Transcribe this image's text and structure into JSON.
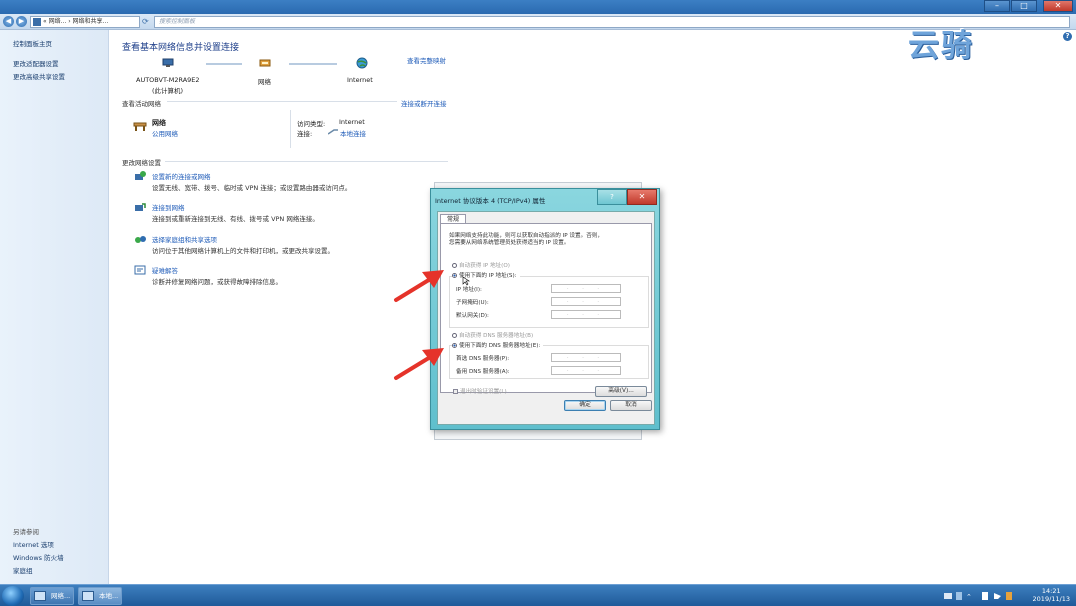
{
  "window": {
    "minimize": "–",
    "maximize": "□",
    "close": "✕"
  },
  "address_bar": {
    "back": "◀",
    "forward": "▶",
    "path": "« 网络... › 网络和共享...",
    "search_placeholder": "搜索控制面板"
  },
  "left_pane": {
    "links": [
      "控制面板主页",
      "更改适配器设置",
      "更改高级共享设置"
    ],
    "see_also_title": "另请参阅",
    "see_also": [
      "Internet 选项",
      "Windows 防火墙",
      "家庭组"
    ]
  },
  "main": {
    "title": "查看基本网络信息并设置连接",
    "view_full_map": "查看完整映射",
    "map": {
      "computer_name": "AUTOBVT-M2RA9E2",
      "computer_sub": "(此计算机)",
      "network": "网络",
      "internet": "Internet"
    },
    "active_networks_title": "查看活动网络",
    "connect_disconnect": "连接或断开连接",
    "active": {
      "name": "网络",
      "type": "公用网络",
      "access_label": "访问类型:",
      "access_value": "Internet",
      "conn_label": "连接:",
      "conn_value": "本地连接"
    },
    "change_title": "更改网络设置",
    "tasks": [
      {
        "title": "设置新的连接或网络",
        "desc": "设置无线、宽带、拨号、临时或 VPN 连接；或设置路由器或访问点。"
      },
      {
        "title": "连接到网络",
        "desc": "连接到或重新连接到无线、有线、拨号或 VPN 网络连接。"
      },
      {
        "title": "选择家庭组和共享选项",
        "desc": "访问位于其他网络计算机上的文件和打印机，或更改共享设置。"
      },
      {
        "title": "疑难解答",
        "desc": "诊断并修复网络问题，或获得故障排除信息。"
      }
    ]
  },
  "watermark": "云骑",
  "dialog": {
    "title": "Internet 协议版本 4 (TCP/IPv4) 属性",
    "help": "?",
    "close": "✕",
    "tab": "常规",
    "intro_line1": "如果网络支持此功能，则可以获取自动指派的 IP 设置。否则，",
    "intro_line2": "您需要从网络系统管理员处获得适当的 IP 设置。",
    "auto_ip": "自动获得 IP 地址(O)",
    "manual_ip": "使用下面的 IP 地址(S):",
    "ip_label": "IP 地址(I):",
    "mask_label": "子网掩码(U):",
    "gateway_label": "默认网关(D):",
    "auto_dns": "自动获得 DNS 服务器地址(B)",
    "manual_dns": "使用下面的 DNS 服务器地址(E):",
    "dns1_label": "首选 DNS 服务器(P):",
    "dns2_label": "备用 DNS 服务器(A):",
    "ip_dots": ". . .",
    "validate": "退出时验证设置(L)",
    "advanced": "高级(V)...",
    "ok": "确定",
    "cancel": "取消"
  },
  "taskbar": {
    "items": [
      "网络...",
      "本地..."
    ],
    "time": "14:21",
    "date": "2019/11/13"
  },
  "colors": {
    "link": "#1e5bb8",
    "title_blue": "#1e3f8a",
    "arrow_red": "#e5332a"
  }
}
